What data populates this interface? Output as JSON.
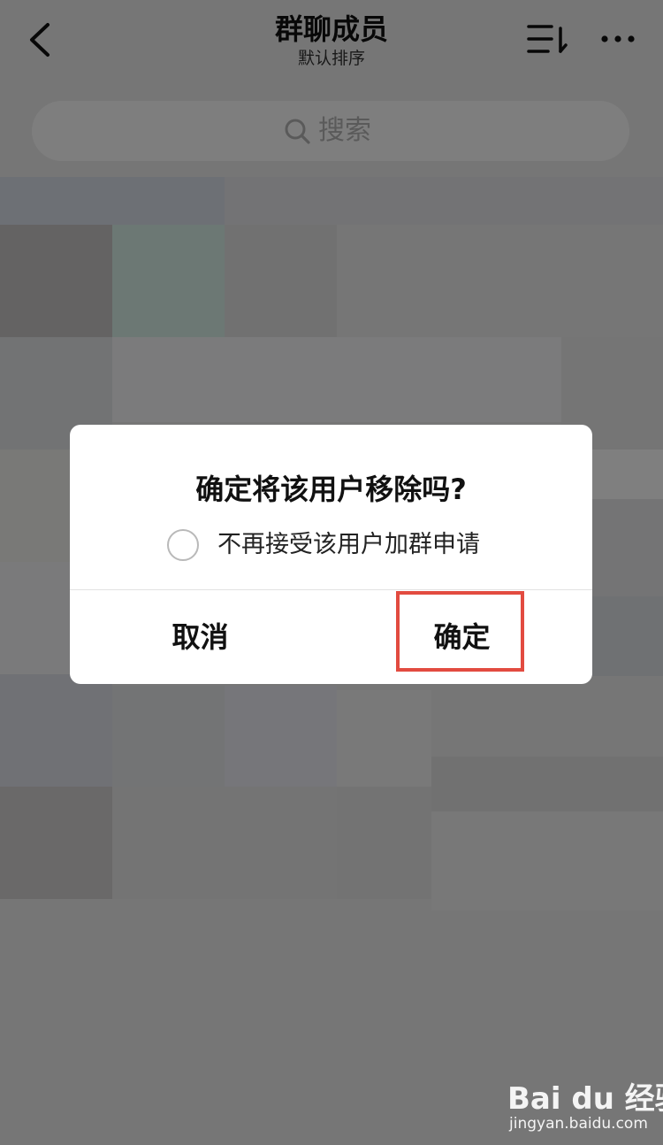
{
  "header": {
    "title": "群聊成员",
    "subtitle": "默认排序"
  },
  "search": {
    "placeholder": "搜索"
  },
  "dialog": {
    "title": "确定将该用户移除吗?",
    "option_label": "不再接受该用户加群申请",
    "option_checked": false,
    "cancel_label": "取消",
    "confirm_label": "确定"
  },
  "watermark": {
    "logo_text": "Bai du 经验",
    "url": "jingyan.baidu.com"
  },
  "colors": {
    "highlight": "#e24b40",
    "overlay": "rgba(0,0,0,0.5)",
    "dialog_bg": "#ffffff",
    "screen_bg": "#ededed"
  }
}
